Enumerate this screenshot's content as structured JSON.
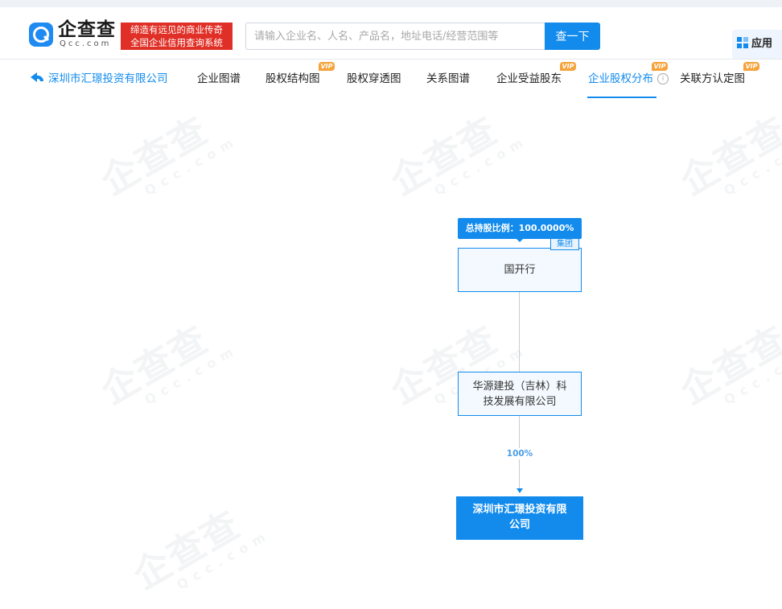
{
  "header": {
    "logo_text": "企查查",
    "logo_sub": "Qcc.com",
    "slogan_line1": "缔造有远见的商业传奇",
    "slogan_line2": "全国企业信用查询系统",
    "search_placeholder": "请输入企业名、人名、产品名，地址电话/经营范围等",
    "search_button": "查一下",
    "app_button": "应用"
  },
  "nav": {
    "back_label": "深圳市汇璟投资有限公司",
    "tabs": [
      {
        "label": "企业图谱",
        "vip": false
      },
      {
        "label": "股权结构图",
        "vip": true
      },
      {
        "label": "股权穿透图",
        "vip": false
      },
      {
        "label": "关系图谱",
        "vip": false
      },
      {
        "label": "企业受益股东",
        "vip": true
      },
      {
        "label": "企业股权分布",
        "vip": true,
        "active": true
      },
      {
        "label": "关联方认定图",
        "vip": true
      }
    ],
    "vip_badge": "VIP"
  },
  "chart": {
    "ratio_label": "总持股比例：100.0000%",
    "group_tag": "集团",
    "top_node": "国开行",
    "mid_node_line1": "华源建投（吉林）科",
    "mid_node_line2": "技发展有限公司",
    "edge_percent": "100%",
    "bottom_node_line1": "深圳市汇璟投资有限",
    "bottom_node_line2": "公司"
  },
  "watermark": {
    "text": "企查查",
    "sub": "Qcc.com"
  },
  "colors": {
    "accent": "#128bed",
    "slogan_bg": "#e02f26",
    "vip": "#f5a33a"
  }
}
